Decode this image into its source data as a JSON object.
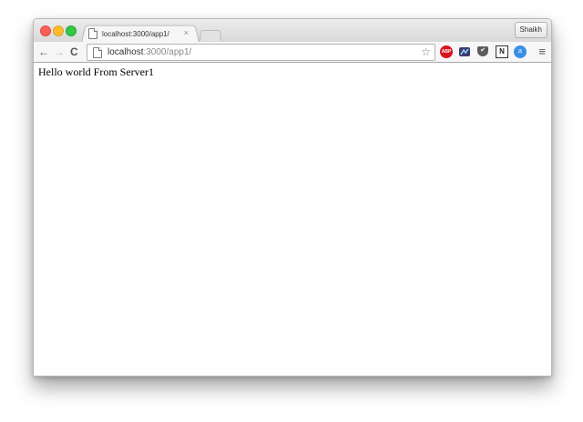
{
  "window": {
    "controls": [
      "close",
      "minimize",
      "maximize"
    ]
  },
  "tab": {
    "title": "localhost:3000/app1/",
    "close_glyph": "×",
    "icon": "page-icon"
  },
  "profile": {
    "name": "Shaikh"
  },
  "toolbar": {
    "back_glyph": "←",
    "forward_glyph": "→",
    "reload_glyph": "C",
    "url_host": "localhost",
    "url_rest": ":3000/app1/",
    "star_glyph": "☆",
    "menu_glyph": "≡",
    "extensions": [
      {
        "name": "adblock-plus-icon",
        "label": "ABP",
        "color": "#d8151e"
      },
      {
        "name": "extension-icon",
        "color": "#3b3b6e"
      },
      {
        "name": "pocket-icon",
        "label": "✔",
        "color": "#5b5b5b"
      },
      {
        "name": "n-extension-icon",
        "label": "N",
        "color": "#222222"
      },
      {
        "name": "extension-blue-icon",
        "label": "a",
        "color": "#3a8ee6"
      }
    ]
  },
  "page": {
    "text": "Hello world From Server1"
  }
}
